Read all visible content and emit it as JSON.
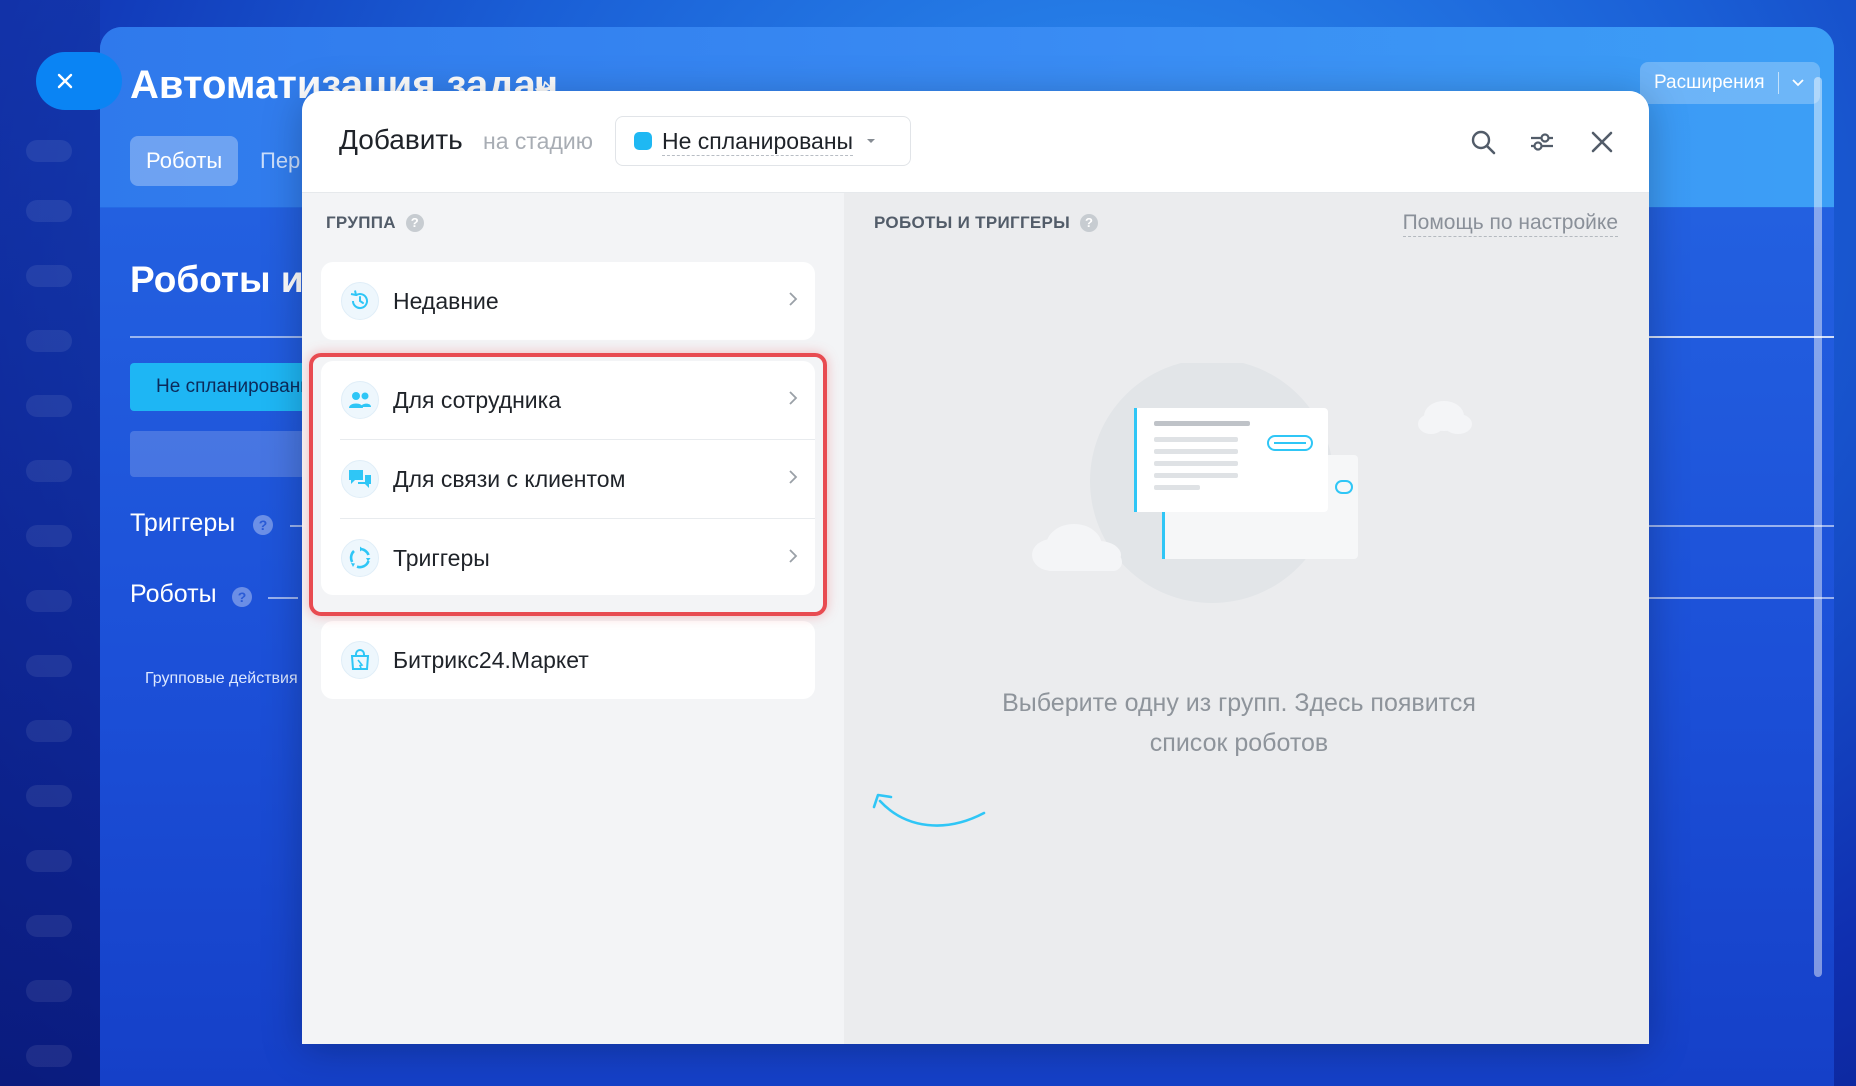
{
  "background": {
    "page_title": "Автоматизация задач",
    "tabs": [
      {
        "label": "Роботы",
        "active": true
      },
      {
        "label": "Пер",
        "active": false
      }
    ],
    "extensions_label": "Расширения",
    "section_title": "Роботы и",
    "stage_chip": "Не спланированы",
    "triggers_label": "Триггеры",
    "robots_label": "Роботы",
    "group_actions": "Групповые действия"
  },
  "modal": {
    "title": "Добавить",
    "subtitle": "на стадию",
    "stage": {
      "label": "Не спланированы",
      "color": "#1fb8f3"
    },
    "header_icons": [
      "search-icon",
      "settings-sliders-icon",
      "close-icon"
    ],
    "group_section": {
      "label": "ГРУППА"
    },
    "robots_section": {
      "label": "РОБОТЫ И ТРИГГЕРЫ",
      "help_link": "Помощь по настройке"
    },
    "groups": [
      {
        "label": "Недавние",
        "icon": "history-icon"
      },
      {
        "label": "Для сотрудника",
        "icon": "employees-icon"
      },
      {
        "label": "Для связи с клиентом",
        "icon": "chat-icon"
      },
      {
        "label": "Триггеры",
        "icon": "trigger-cycle-icon"
      },
      {
        "label": "Битрикс24.Маркет",
        "icon": "market-bag-icon"
      }
    ],
    "empty_state": {
      "line1": "Выберите одну из групп. Здесь появится",
      "line2": "список роботов"
    }
  },
  "colors": {
    "accent": "#2fc6f6",
    "highlight_border": "#e84b51",
    "stage_dot": "#1fb8f3"
  }
}
